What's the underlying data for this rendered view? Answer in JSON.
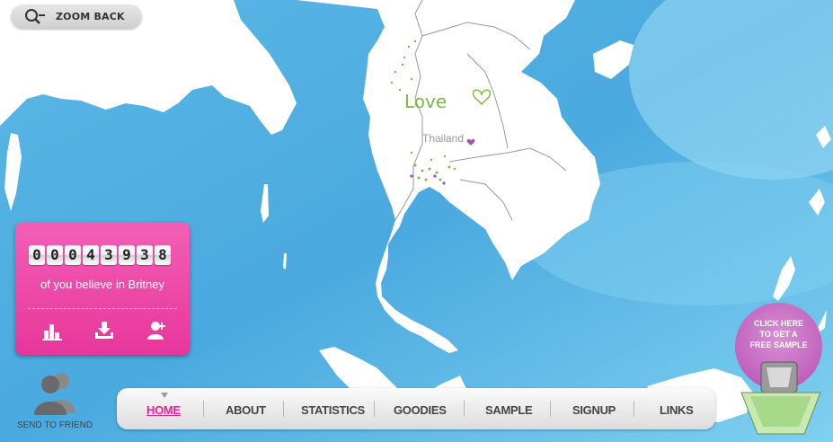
{
  "toolbar": {
    "zoom_back_label": "ZOOM BACK"
  },
  "map": {
    "country_label": "Thailand",
    "love_text": "Love"
  },
  "counter": {
    "digits": [
      "0",
      "0",
      "0",
      "4",
      "3",
      "9",
      "3",
      "8"
    ],
    "caption": "of you believe in Britney"
  },
  "send_friend": {
    "label": "SEND TO FRIEND"
  },
  "nav": {
    "items": [
      {
        "label": "HOME",
        "active": true
      },
      {
        "label": "ABOUT"
      },
      {
        "label": "STATISTICS"
      },
      {
        "label": "GOODIES"
      },
      {
        "label": "SAMPLE"
      },
      {
        "label": "SIGNUP"
      },
      {
        "label": "LINKS"
      }
    ]
  },
  "promo": {
    "line1": "CLICK HERE",
    "line2": "TO GET A",
    "line3": "FREE SAMPLE"
  },
  "colors": {
    "sea": "#6ec8ec",
    "land": "#ffffff",
    "pink": "#e8369a",
    "nav_active": "#e6249a"
  },
  "icons": [
    "magnifier-zoom-out-icon",
    "bar-chart-icon",
    "download-tray-icon",
    "user-add-icon",
    "users-icon",
    "perfume-bottle-icon"
  ]
}
